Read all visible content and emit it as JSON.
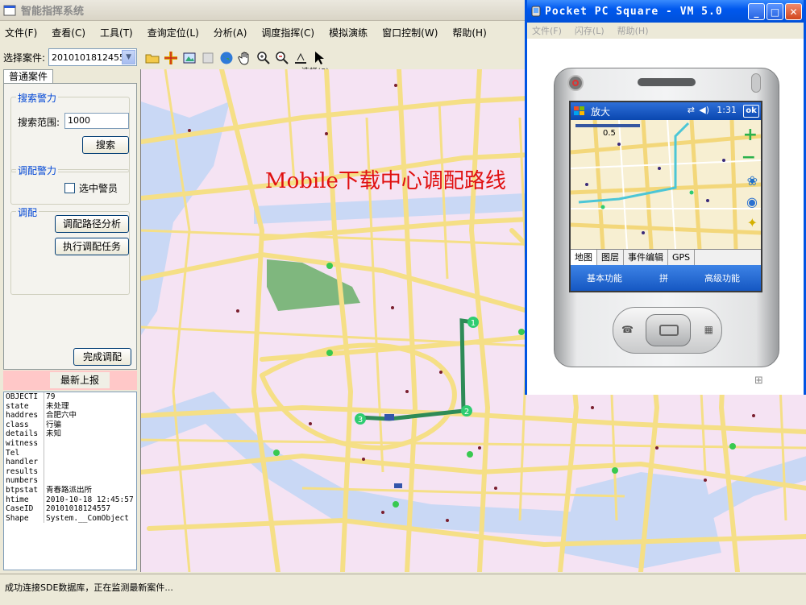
{
  "app": {
    "title": "智能指挥系统",
    "menu": [
      "文件(F)",
      "查看(C)",
      "工具(T)",
      "查询定位(L)",
      "分析(A)",
      "调度指挥(C)",
      "模拟演练",
      "窗口控制(W)",
      "帮助(H)"
    ]
  },
  "case_selector": {
    "label": "选择案件:",
    "value": "20101018124557"
  },
  "toolbar": {
    "icons": [
      "open-folder-icon",
      "add-layer-icon",
      "identify-icon",
      "clear-icon",
      "globe-icon",
      "pan-hand-icon",
      "zoom-in-icon",
      "zoom-out-icon",
      "measure-icon",
      "select-arrow-icon"
    ],
    "tooltip_fragment": "选择(S)"
  },
  "left_panel": {
    "tab_label": "普通案件",
    "search_group": {
      "title": "搜索警力",
      "range_label": "搜索范围:",
      "range_value": "1000",
      "search_button": "搜索"
    },
    "dispatch_group": {
      "title": "调配警力",
      "checkbox_label": "选中警员"
    },
    "deploy_group": {
      "title": "调配",
      "route_button": "调配路径分析",
      "execute_button": "执行调配任务"
    },
    "finish_button": "完成调配",
    "report_header": "最新上报",
    "properties": [
      {
        "k": "OBJECTI",
        "v": "79"
      },
      {
        "k": "state",
        "v": "未处理"
      },
      {
        "k": "haddres",
        "v": "合肥六中"
      },
      {
        "k": "class",
        "v": "行骗"
      },
      {
        "k": "details",
        "v": "未知"
      },
      {
        "k": "witness",
        "v": ""
      },
      {
        "k": "Tel",
        "v": ""
      },
      {
        "k": "handler",
        "v": ""
      },
      {
        "k": "results",
        "v": ""
      },
      {
        "k": "numbers",
        "v": ""
      },
      {
        "k": "btpstat",
        "v": "青春路派出所"
      },
      {
        "k": "htime",
        "v": "2010-10-18 12:45:57"
      },
      {
        "k": "CaseID",
        "v": "20101018124557"
      },
      {
        "k": "Shape",
        "v": "System.__ComObject"
      }
    ]
  },
  "map": {
    "caption": "Mobile下载中心调配路线",
    "route_markers": [
      "1",
      "2",
      "3"
    ],
    "colors": {
      "background": "#f5e3f3",
      "road": "#f5df86",
      "water": "#c9d8f5",
      "park": "#7fb77e",
      "route": "#2e8b57",
      "marker": "#2ecc71"
    }
  },
  "status_bar": {
    "text": "成功连接SDE数据库，正在监测最新案件..."
  },
  "emulator": {
    "title": "Pocket PC Square - VM 5.0",
    "menu": [
      "文件(F)",
      "闪存(L)",
      "帮助(H)"
    ],
    "device": {
      "app_title": "放大",
      "time": "1:31",
      "ok": "ok",
      "scale_label": "0.5",
      "tabs": [
        "地图",
        "图层",
        "事件编辑",
        "GPS"
      ],
      "bottom_left": "基本功能",
      "bottom_mid": "拼",
      "bottom_right": "高级功能"
    }
  }
}
